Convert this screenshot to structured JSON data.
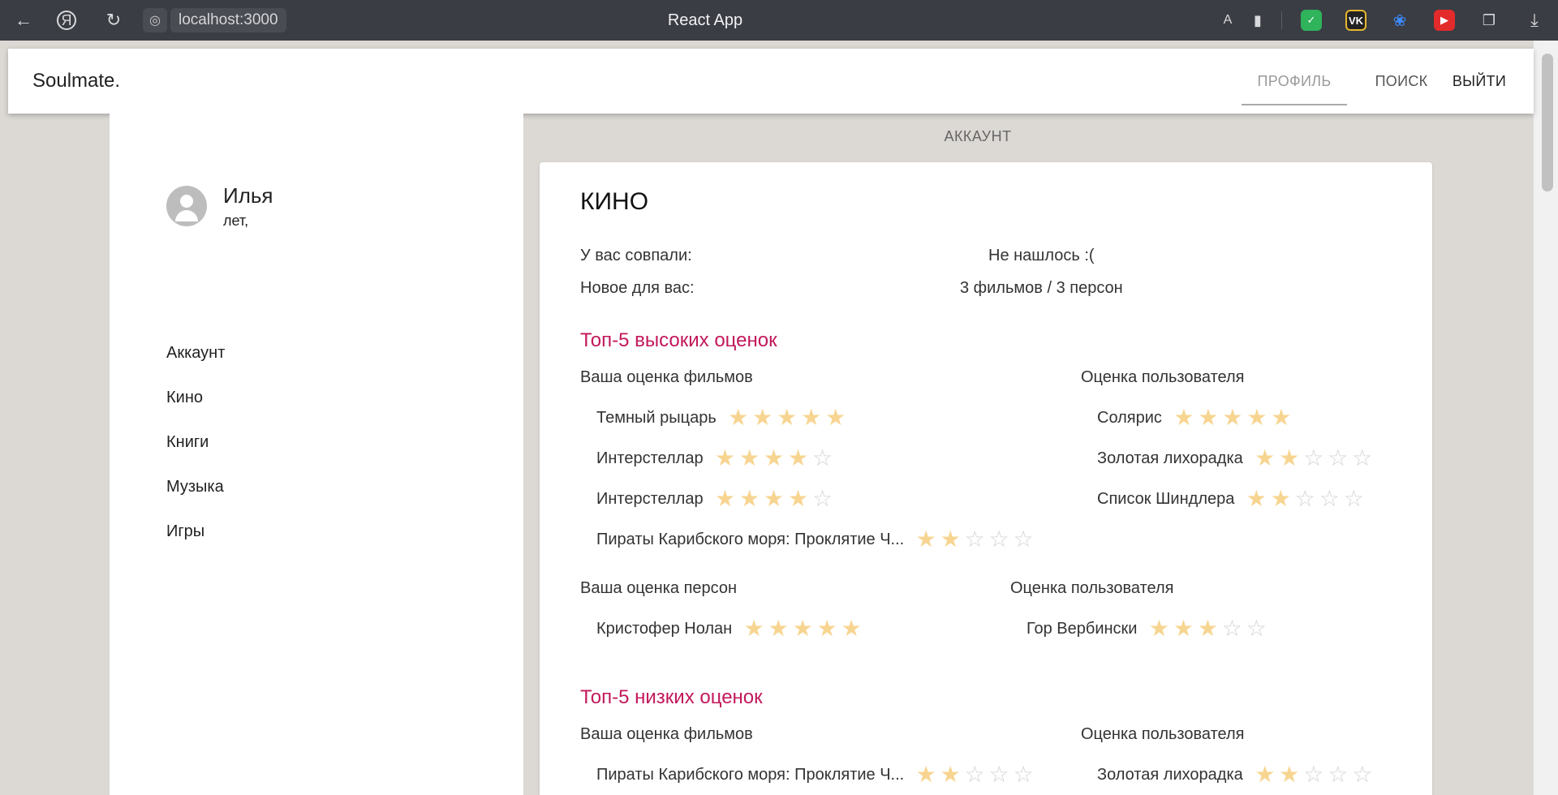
{
  "browser": {
    "title": "React App",
    "url": "localhost:3000"
  },
  "app": {
    "logo": "Soulmate.",
    "nav": [
      "ПРОФИЛЬ",
      "ПОИСК",
      "ВЫЙТИ"
    ]
  },
  "user": {
    "name": "Илья",
    "age_text": "лет,"
  },
  "sidebar": {
    "items": [
      "Аккаунт",
      "Кино",
      "Книги",
      "Музыка",
      "Игры"
    ]
  },
  "section_label": "АККАУНТ",
  "card": {
    "title": "КИНО",
    "matched_label": "У вас совпали:",
    "matched_value": "Не нашлось :(",
    "new_label": "Новое для вас:",
    "new_value": "3 фильмов / 3 персон",
    "top": {
      "heading": "Топ-5 высоких оценок",
      "films_yours_label": "Ваша оценка фильмов",
      "films_user_label": "Оценка пользователя",
      "films_yours": [
        {
          "name": "Темный рыцарь",
          "rating": 5
        },
        {
          "name": "Интерстеллар",
          "rating": 4
        },
        {
          "name": "Интерстеллар",
          "rating": 4
        },
        {
          "name": "Пираты Карибского моря: Проклятие Ч...",
          "rating": 2
        }
      ],
      "films_user": [
        {
          "name": "Солярис",
          "rating": 5
        },
        {
          "name": "Золотая лихорадка",
          "rating": 2
        },
        {
          "name": "Список Шиндлера",
          "rating": 2
        }
      ],
      "persons_yours_label": "Ваша оценка персон",
      "persons_user_label": "Оценка пользователя",
      "persons_yours": [
        {
          "name": "Кристофер Нолан",
          "rating": 5
        }
      ],
      "persons_user": [
        {
          "name": "Гор Вербински",
          "rating": 3
        }
      ]
    },
    "low": {
      "heading": "Топ-5 низких оценок",
      "films_yours_label": "Ваша оценка фильмов",
      "films_user_label": "Оценка пользователя",
      "films_yours": [
        {
          "name": "Пираты Карибского моря: Проклятие Ч...",
          "rating": 2
        }
      ],
      "films_user": [
        {
          "name": "Золотая лихорадка",
          "rating": 2
        }
      ]
    }
  },
  "colors": {
    "accent_heading": "#c2185b",
    "star_full": "#f7d591",
    "star_empty": "#d3d3d3"
  }
}
